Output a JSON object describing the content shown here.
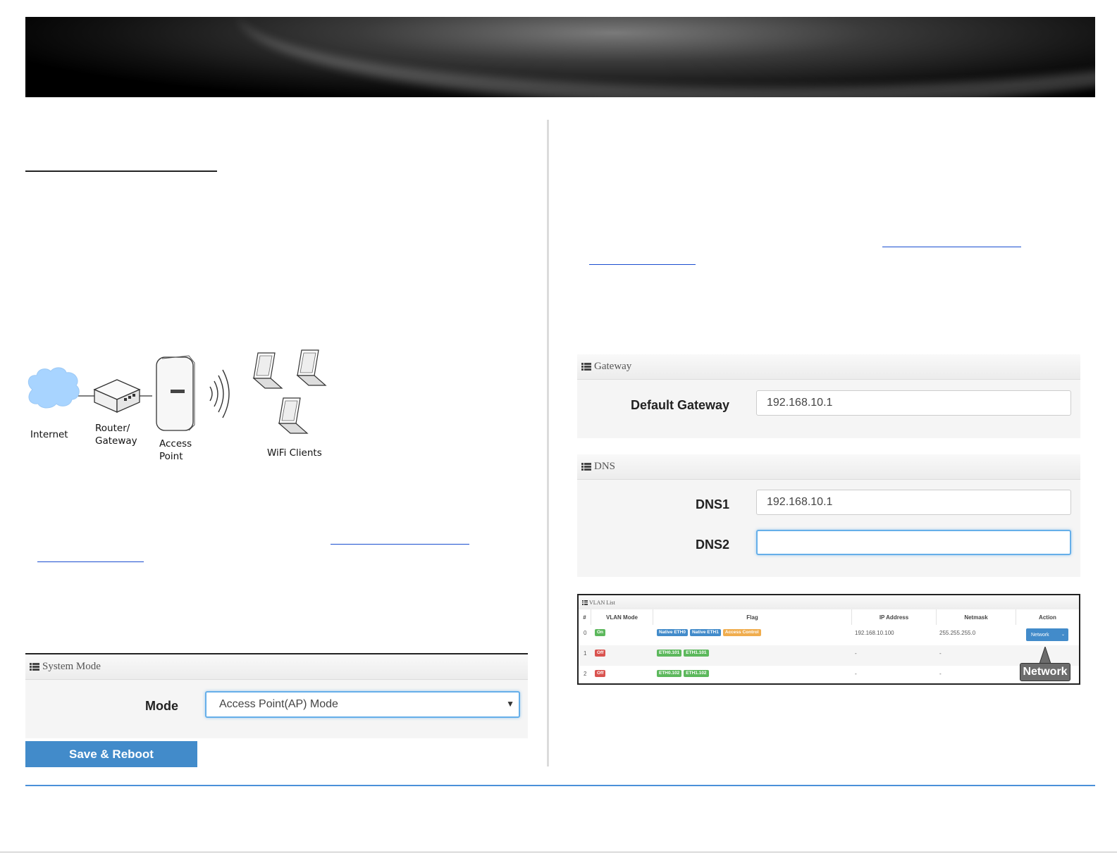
{
  "diagram": {
    "labels": {
      "internet": "Internet",
      "router_line1": "Router/",
      "router_line2": "Gateway",
      "ap_line1": "Access",
      "ap_line2": "Point",
      "clients": "WiFi Clients"
    },
    "cloud_color": "#a8d4ff"
  },
  "system_mode": {
    "title": "System Mode",
    "mode_label": "Mode",
    "mode_value": "Access Point(AP) Mode",
    "save_button": "Save & Reboot"
  },
  "gateway": {
    "title": "Gateway",
    "default_gateway_label": "Default Gateway",
    "default_gateway_value": "192.168.10.1"
  },
  "dns": {
    "title": "DNS",
    "dns1_label": "DNS1",
    "dns1_value": "192.168.10.1",
    "dns2_label": "DNS2",
    "dns2_value": ""
  },
  "vlan_list": {
    "title": "VLAN List",
    "columns": [
      "#",
      "VLAN Mode",
      "Flag",
      "IP Address",
      "Netmask",
      "Action"
    ],
    "rows": [
      {
        "index": "0",
        "mode": "On",
        "flags": [
          "Native ETH0",
          "Native ETH1",
          "Access Control"
        ],
        "ip": "192.168.10.100",
        "netmask": "255.255.255.0",
        "action": "Network"
      },
      {
        "index": "1",
        "mode": "Off",
        "flags": [
          "ETH0.101",
          "ETH1.101"
        ],
        "ip": "-",
        "netmask": "-"
      },
      {
        "index": "2",
        "mode": "Off",
        "flags": [
          "ETH0.102",
          "ETH1.102"
        ],
        "ip": "-",
        "netmask": "-"
      }
    ],
    "callout": "Network"
  },
  "colors": {
    "primary_button": "#428bca",
    "focus_border": "#66afe9",
    "footer_rule": "#4a90d9",
    "badge_on": "#5cb85c",
    "badge_off": "#d9534f",
    "badge_native": "#428bca",
    "badge_access": "#f0ad4e"
  }
}
